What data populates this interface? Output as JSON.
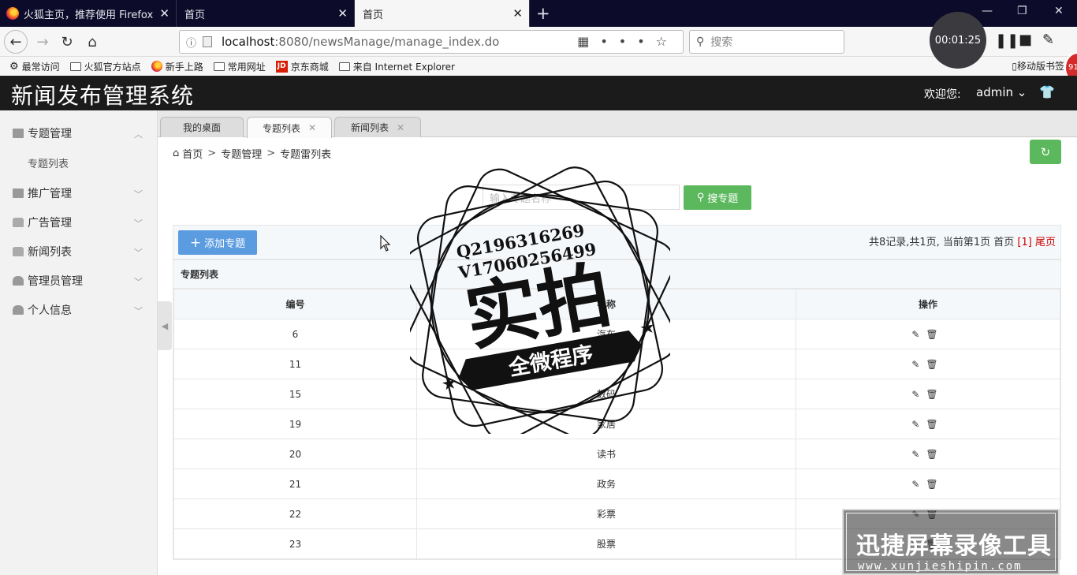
{
  "browser": {
    "tabs": [
      {
        "title": "火狐主页，推荐使用 Firefox 火"
      },
      {
        "title": "首页"
      },
      {
        "title": "首页"
      }
    ],
    "url": {
      "host": "localhost",
      "path": ":8080/newsManage/manage_index.do"
    },
    "search_placeholder": "搜索",
    "bookmarks": [
      "最常访问",
      "火狐官方站点",
      "新手上路",
      "常用网址",
      "京东商城",
      "来自 Internet Explorer"
    ],
    "mobile_bookmarks": "移动版书签",
    "recorder_time": "00:01:25",
    "badge": "91"
  },
  "app": {
    "title": "新闻发布管理系统",
    "welcome": "欢迎您:",
    "user": "admin"
  },
  "sidebar": {
    "items": [
      {
        "label": "专题管理"
      },
      {
        "label": "推广管理"
      },
      {
        "label": "广告管理"
      },
      {
        "label": "新闻列表"
      },
      {
        "label": "管理员管理"
      },
      {
        "label": "个人信息"
      }
    ],
    "sub_items": [
      "专题列表"
    ]
  },
  "content_tabs": [
    "我的桌面",
    "专题列表",
    "新闻列表"
  ],
  "breadcrumb": [
    "首页",
    "专题管理",
    "专题雷列表"
  ],
  "search": {
    "placeholder": "输入专题名称",
    "button": "搜专题"
  },
  "toolbar": {
    "add_label": "添加专题",
    "pager_text": "共8记录,共1页, 当前第1页 首页",
    "pager_current": "[1]",
    "pager_last": "尾页"
  },
  "table": {
    "caption": "专题列表",
    "headers": [
      "编号",
      "名称",
      "操作"
    ],
    "rows": [
      {
        "id": "6",
        "name": "汽车"
      },
      {
        "id": "11",
        "name": ""
      },
      {
        "id": "15",
        "name": "数码"
      },
      {
        "id": "19",
        "name": "家居"
      },
      {
        "id": "20",
        "name": "读书"
      },
      {
        "id": "21",
        "name": "政务"
      },
      {
        "id": "22",
        "name": "彩票"
      },
      {
        "id": "23",
        "name": "股票"
      }
    ]
  },
  "watermark": {
    "line1": "Q2196316269",
    "line2": "V17060256499",
    "main": "实拍",
    "banner": "全微程序"
  },
  "recorder_brand": {
    "title": "迅捷屏幕录像工具",
    "url": "www.xunjieshipin.com"
  }
}
